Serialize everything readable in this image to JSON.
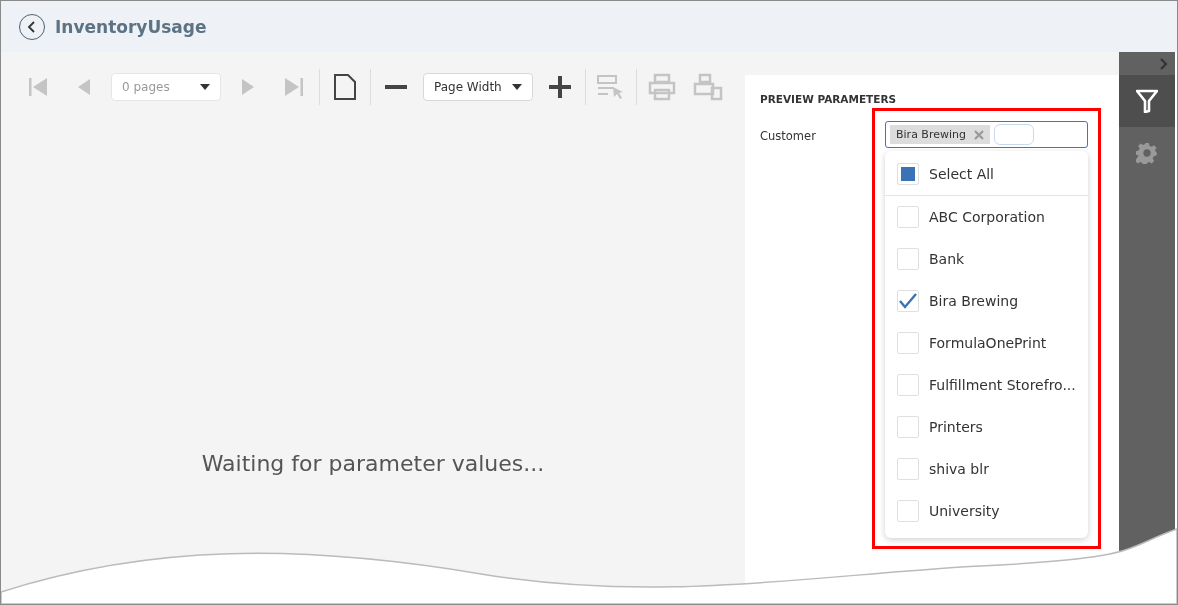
{
  "window": {
    "title": "InventoryUsage"
  },
  "toolbar": [
    {
      "kind": "first",
      "disabled": true
    },
    {
      "kind": "prev",
      "disabled": true
    },
    {
      "kind": "pages",
      "placeholder": "0 pages",
      "disabled": true
    },
    {
      "kind": "next",
      "disabled": true
    },
    {
      "kind": "last",
      "disabled": true
    },
    {
      "kind": "sep"
    },
    {
      "kind": "page",
      "disabled": false
    },
    {
      "kind": "sep"
    },
    {
      "kind": "zoomout",
      "disabled": false
    },
    {
      "kind": "zoom",
      "value": "Page Width",
      "disabled": false
    },
    {
      "kind": "zoomin",
      "disabled": false
    },
    {
      "kind": "sep"
    },
    {
      "kind": "select",
      "disabled": true
    },
    {
      "kind": "sep"
    },
    {
      "kind": "print",
      "disabled": true
    },
    {
      "kind": "printpage",
      "disabled": true
    }
  ],
  "message": "Waiting for parameter values...",
  "panel": {
    "title": "PREVIEW PARAMETERS",
    "parameter": {
      "label": "Customer",
      "tags": [
        "Bira Brewing"
      ]
    },
    "select_all": {
      "label": "Select All",
      "indeterminate": true
    },
    "options": [
      {
        "label": "ABC Corporation",
        "checked": false
      },
      {
        "label": "Bank",
        "checked": false
      },
      {
        "label": "Bira Brewing",
        "checked": true
      },
      {
        "label": "FormulaOnePrint",
        "checked": false
      },
      {
        "label": "Fulfillment Storefro...",
        "checked": false
      },
      {
        "label": "Printers",
        "checked": false
      },
      {
        "label": "shiva blr",
        "checked": false
      },
      {
        "label": "University",
        "checked": false
      }
    ]
  },
  "side_tabs": [
    {
      "kind": "filter",
      "selected": true
    },
    {
      "kind": "settings",
      "selected": false
    }
  ]
}
